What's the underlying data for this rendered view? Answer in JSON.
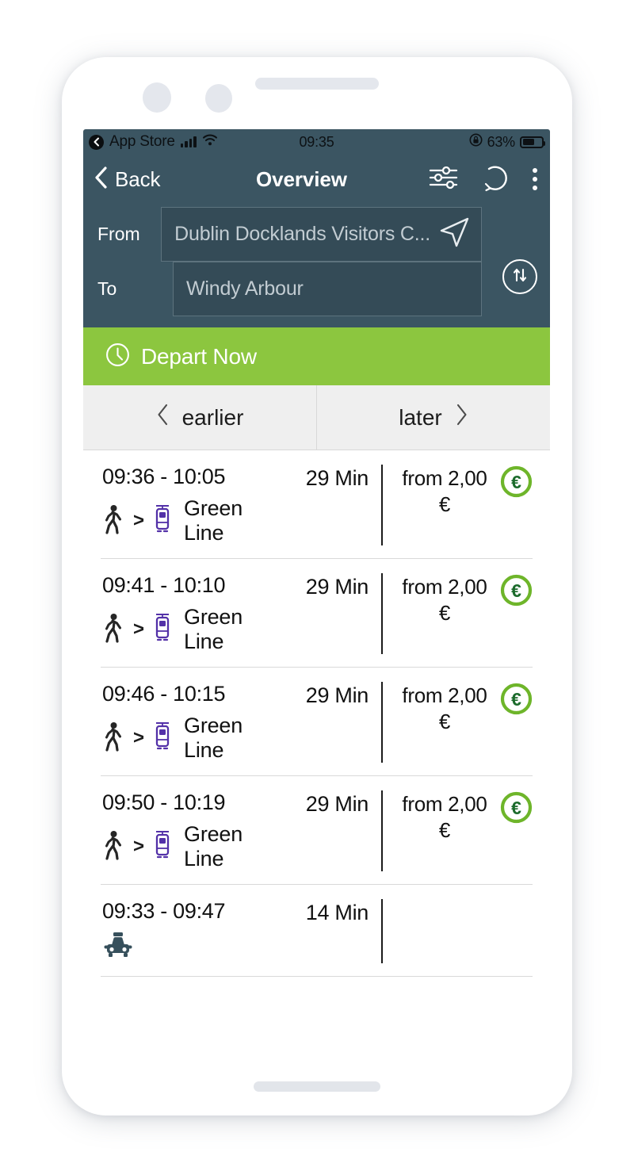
{
  "status_bar": {
    "back_app": "App Store",
    "time": "09:35",
    "battery_pct": "63%",
    "icons": [
      "signal-bars-icon",
      "wifi-icon",
      "rotation-lock-icon",
      "battery-icon"
    ]
  },
  "nav_bar": {
    "back_label": "Back",
    "title": "Overview",
    "filter_icon": "sliders-filter-icon",
    "refresh_icon": "refresh-circular-arrow-icon",
    "menu_icon": "overflow-menu-icon"
  },
  "route_form": {
    "from_label": "From",
    "from_value": "Dublin Docklands Visitors C...",
    "from_placeholder": "From",
    "to_label": "To",
    "to_value": "Windy Arbour",
    "to_placeholder": "To",
    "locate_icon": "navigation-arrow-icon",
    "swap_icon": "swap-vertical-icon"
  },
  "depart_bar": {
    "label": "Depart Now",
    "icon": "clock-icon"
  },
  "time_nav": {
    "earlier_label": "earlier",
    "later_label": "later",
    "earlier_icon": "chevron-left-icon",
    "later_icon": "chevron-right-icon"
  },
  "results": [
    {
      "time": "09:36 - 10:05",
      "duration": "29 Min",
      "modes": [
        "walk-icon",
        "tram-icon"
      ],
      "separator": ">",
      "line_name": "Green Line",
      "fare": "from 2,00 €",
      "fare_icon": "euro-circle-icon"
    },
    {
      "time": "09:41 - 10:10",
      "duration": "29 Min",
      "modes": [
        "walk-icon",
        "tram-icon"
      ],
      "separator": ">",
      "line_name": "Green Line",
      "fare": "from 2,00 €",
      "fare_icon": "euro-circle-icon"
    },
    {
      "time": "09:46 - 10:15",
      "duration": "29 Min",
      "modes": [
        "walk-icon",
        "tram-icon"
      ],
      "separator": ">",
      "line_name": "Green Line",
      "fare": "from 2,00 €",
      "fare_icon": "euro-circle-icon"
    },
    {
      "time": "09:50 - 10:19",
      "duration": "29 Min",
      "modes": [
        "walk-icon",
        "tram-icon"
      ],
      "separator": ">",
      "line_name": "Green Line",
      "fare": "from 2,00 €",
      "fare_icon": "euro-circle-icon"
    },
    {
      "time": "09:33 - 09:47",
      "duration": "14 Min",
      "modes": [
        "taxi-icon"
      ],
      "separator": "",
      "line_name": "",
      "fare": "",
      "fare_icon": ""
    }
  ],
  "colors": {
    "header_slate": "#3b5562",
    "field_fill": "#344b57",
    "accent_green": "#8cc63f",
    "tram_purple": "#5331a8",
    "euro_green": "#6eb52a",
    "euro_symbol_green": "#1c6b2c",
    "taxi_slate": "#37505c",
    "bar_gray": "#efefef"
  }
}
